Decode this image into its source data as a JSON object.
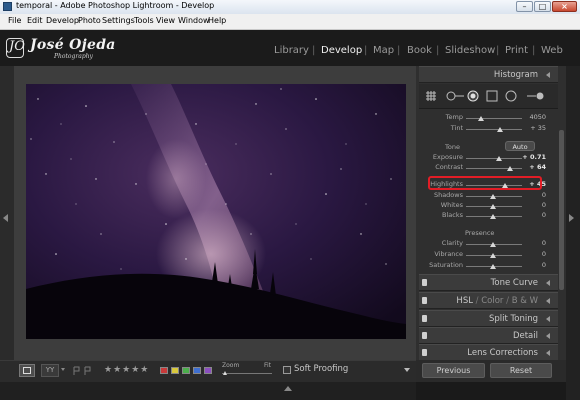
{
  "window": {
    "title": "temporal - Adobe Photoshop Lightroom - Develop"
  },
  "menu": [
    "File",
    "Edit",
    "Develop",
    "Photo",
    "Settings",
    "Tools",
    "View",
    "Window",
    "Help"
  ],
  "identity": {
    "mark": "JO",
    "name": "José Ojeda",
    "subtitle": "Photography"
  },
  "modules": [
    {
      "label": "Library",
      "active": false
    },
    {
      "label": "Develop",
      "active": true
    },
    {
      "label": "Map",
      "active": false
    },
    {
      "label": "Book",
      "active": false
    },
    {
      "label": "Slideshow",
      "active": false
    },
    {
      "label": "Print",
      "active": false
    },
    {
      "label": "Web",
      "active": false
    }
  ],
  "panels": {
    "histogram": "Histogram",
    "tone_curve": "Tone Curve",
    "hsl": {
      "hsl": "HSL",
      "color": "Color",
      "bw": "B & W",
      "sep": "/"
    },
    "split_toning": "Split Toning",
    "detail": "Detail",
    "lens_corrections": "Lens Corrections"
  },
  "basic": {
    "wb": [
      {
        "label": "Temp",
        "value": "4050"
      },
      {
        "label": "Tint",
        "value": "+ 35"
      }
    ],
    "tone_label": "Tone",
    "auto_label": "Auto",
    "tone": [
      {
        "label": "Exposure",
        "value": "+ 0.71",
        "bold": true
      },
      {
        "label": "Contrast",
        "value": "+ 64",
        "bold": true
      },
      {
        "label": "Highlights",
        "value": "+ 45",
        "bold": true
      },
      {
        "label": "Shadows",
        "value": "0",
        "bold": false
      },
      {
        "label": "Whites",
        "value": "0",
        "bold": false
      },
      {
        "label": "Blacks",
        "value": "0",
        "bold": false
      }
    ],
    "presence_label": "Presence",
    "presence": [
      {
        "label": "Clarity",
        "value": "0"
      },
      {
        "label": "Vibrance",
        "value": "0"
      },
      {
        "label": "Saturation",
        "value": "0"
      }
    ]
  },
  "bottom": {
    "zoom_label": "Zoom",
    "fit_label": "Fit",
    "soft_proofing": "Soft Proofing",
    "previous": "Previous",
    "reset": "Reset",
    "flag_colors": [
      "#c83a3a",
      "#d8c83c",
      "#4cae4c",
      "#3f6fd0",
      "#8b4fbf"
    ]
  }
}
